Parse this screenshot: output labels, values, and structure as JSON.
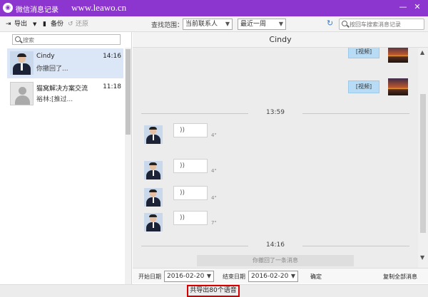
{
  "window": {
    "title": "微信消息记录",
    "site": "www.leawo.cn",
    "controls": {
      "minimize": "—",
      "close": "✕"
    }
  },
  "toolbar": {
    "export_label": "导出",
    "export_caret": "▼",
    "backup_label": "备份",
    "restore_label": "还原",
    "scope_label": "查找范围：",
    "scope_value": "当前联系人",
    "period_value": "最近一周",
    "search_placeholder": "按回车搜索消息记录"
  },
  "sidebar": {
    "search_placeholder": "搜索",
    "contacts": [
      {
        "name": "Cindy",
        "time": "14:16",
        "preview": "你撤回了..."
      },
      {
        "name": "猫窝解决方案交流",
        "time": "11:18",
        "preview": "裕林:[推过..."
      }
    ]
  },
  "chat": {
    "contact_name": "Cindy",
    "messages": [
      {
        "type": "video",
        "label": "[视频]"
      },
      {
        "type": "video",
        "label": "[视频]"
      }
    ],
    "time_separator_1": "13:59",
    "voice_messages": [
      {
        "duration": "4\""
      },
      {
        "duration": "4\""
      },
      {
        "duration": "4\""
      },
      {
        "duration": "7\""
      }
    ],
    "voice_glyph": "))",
    "time_separator_2": "14:16",
    "recall_notice": "你撤回了一条消息"
  },
  "bottom": {
    "start_label": "开始日期",
    "start_date": "2016-02-20",
    "end_label": "结束日期",
    "end_date": "2016-02-20",
    "confirm_label": "确定",
    "copy_all_label": "复制全部消息"
  },
  "status": {
    "text": "共导出80个语音"
  },
  "colors": {
    "titlebar": "#8d36cf",
    "highlight": "#d60000",
    "selected": "#dbe6f7"
  }
}
